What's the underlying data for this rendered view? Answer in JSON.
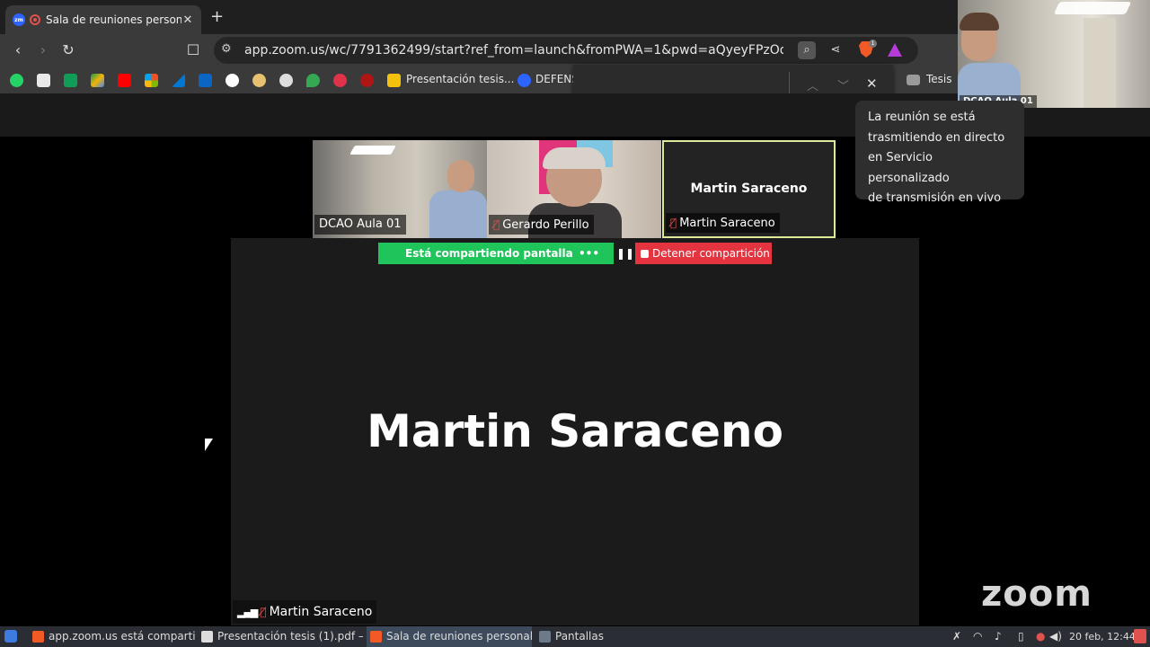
{
  "browser": {
    "tab_title": "Sala de reuniones persona",
    "tab_favicon": "zm",
    "new_tab": "+",
    "url": "app.zoom.us/wc/7791362499/start?ref_from=launch&fromPWA=1&pwd=aQyeyFPzOobIDbka6N...",
    "brave_badge": "1"
  },
  "bookmarks": [
    {
      "label": "Presentación tesis...",
      "color": "#f4c20d"
    },
    {
      "label": "DEFENS",
      "color": "#2d64ff"
    },
    {
      "label": "Tesis",
      "color": "#9a9a9a"
    }
  ],
  "self_view": {
    "label": "DCAO Aula 01"
  },
  "tooltip": {
    "text_lines": [
      "La reunión se está",
      "trasmitiendo en directo",
      "en Servicio personalizado",
      "de transmisión en vivo"
    ]
  },
  "participants": [
    {
      "name": "DCAO Aula 01",
      "muted": false
    },
    {
      "name": "Gerardo Perillo",
      "muted": true
    },
    {
      "name": "Martin Saraceno",
      "muted": true,
      "display_name": "Martin Saraceno"
    }
  ],
  "share": {
    "status": "Está compartiendo pantalla",
    "more": "•••",
    "pause": "❚❚",
    "stop": "Detener compartición"
  },
  "stage": {
    "big_name": "Martin Saraceno",
    "bottom_name": "Martin Saraceno"
  },
  "logo": "zoom",
  "taskbar": {
    "tasks": [
      {
        "label": "app.zoom.us está compartie..."
      },
      {
        "label": "Presentación tesis (1).pdf —..."
      },
      {
        "label": "Sala de reuniones personal..."
      },
      {
        "label": "Pantallas"
      }
    ],
    "clock": "20 feb, 12:44"
  },
  "colors": {
    "share_green": "#1fc45b",
    "stop_red": "#e3343f",
    "active_speaker": "#dfe79b"
  }
}
